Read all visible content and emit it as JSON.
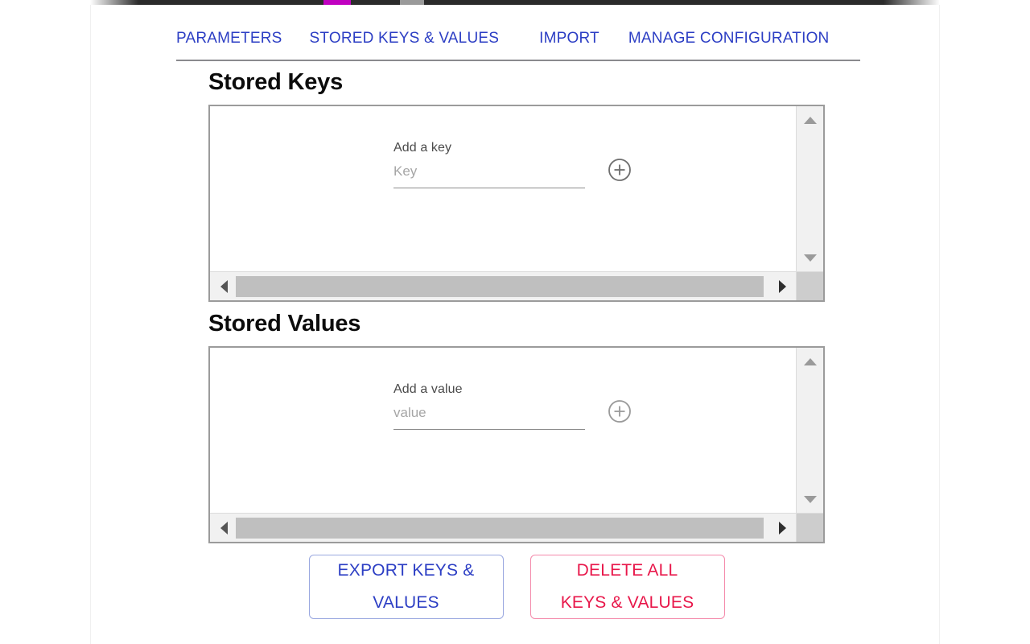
{
  "chrome": {
    "accent_magenta": "#c000c0",
    "bar_color": "#2b2b2b"
  },
  "colors": {
    "tab_blue": "#2c3ec4",
    "delete_red": "#e8174a",
    "delete_border": "#f48aab",
    "export_border": "#9aa8e0",
    "panel_border": "#9b9b9b",
    "scroll_thumb": "#bfbfbf",
    "heading": "#0c0c0c"
  },
  "tabs": [
    {
      "id": "parameters",
      "label": "PARAMETERS"
    },
    {
      "id": "stored-keys-values",
      "label": "STORED KEYS & VALUES"
    },
    {
      "id": "import",
      "label": "IMPORT"
    },
    {
      "id": "manage-configuration",
      "label": "MANAGE CONFIGURATION"
    }
  ],
  "sections": {
    "keys": {
      "heading": "Stored Keys",
      "add_label": "Add a key",
      "input_placeholder": "Key",
      "input_value": "",
      "add_icon": "plus-circle-icon"
    },
    "values": {
      "heading": "Stored Values",
      "add_label": "Add a value",
      "input_placeholder": "value",
      "input_value": "",
      "add_icon": "plus-circle-icon"
    }
  },
  "scrollbars": {
    "up_icon": "triangle-up-icon",
    "down_icon": "triangle-down-icon",
    "left_icon": "triangle-left-icon",
    "right_icon": "triangle-right-icon"
  },
  "actions": {
    "export": {
      "line1": "EXPORT KEYS &",
      "line2": "VALUES"
    },
    "delete": {
      "line1": "DELETE ALL",
      "line2": "KEYS & VALUES"
    }
  }
}
